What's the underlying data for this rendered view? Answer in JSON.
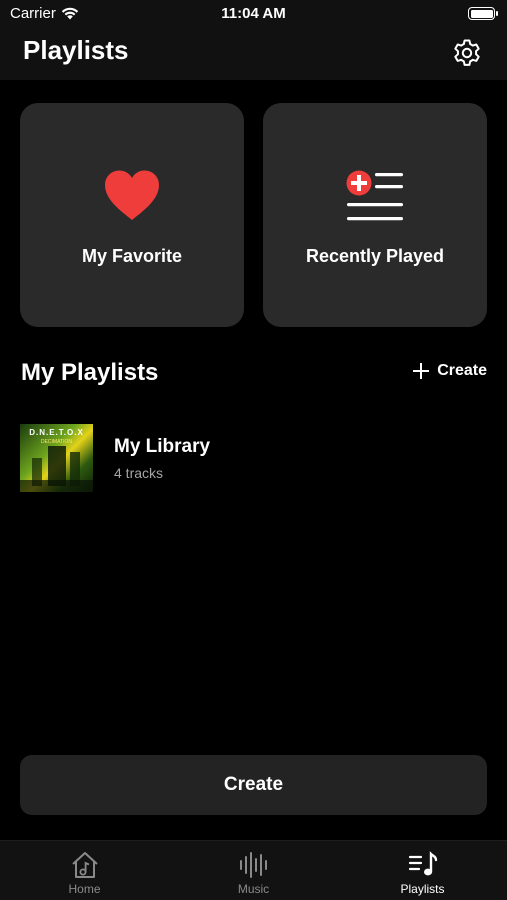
{
  "status_bar": {
    "carrier": "Carrier",
    "time": "11:04 AM"
  },
  "header": {
    "title": "Playlists",
    "settings_icon": "gear-icon"
  },
  "quick_cards": [
    {
      "label": "My Favorite",
      "icon": "heart-icon",
      "icon_color": "#ee3d3a"
    },
    {
      "label": "Recently Played",
      "icon": "playlist-add-icon",
      "icon_color": "#ee3d3a"
    }
  ],
  "my_playlists": {
    "title": "My Playlists",
    "create_label": "Create",
    "items": [
      {
        "title": "My Library",
        "subtitle": "4 tracks",
        "cover_text": "D.N.E.T.O.X",
        "cover_subtext": "DECIMATION"
      }
    ]
  },
  "create_button": {
    "label": "Create"
  },
  "tab_bar": {
    "tabs": [
      {
        "label": "Home",
        "icon": "home-music-icon",
        "active": false
      },
      {
        "label": "Music",
        "icon": "waveform-icon",
        "active": false
      },
      {
        "label": "Playlists",
        "icon": "playlist-music-icon",
        "active": true
      }
    ]
  },
  "colors": {
    "background": "#000000",
    "card": "#2a2a2a",
    "accent": "#ee3d3a"
  }
}
